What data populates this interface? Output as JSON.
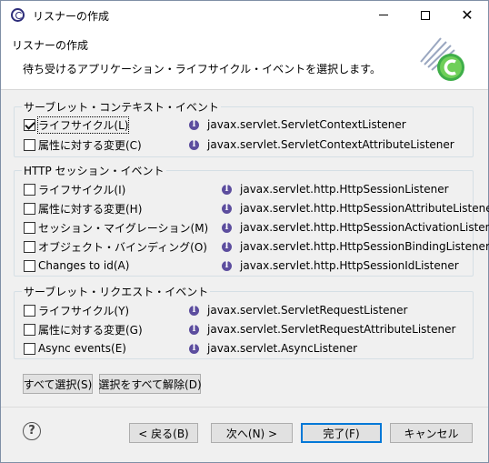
{
  "window": {
    "title": "リスナーの作成"
  },
  "header": {
    "title": "リスナーの作成",
    "description": "待ち受けるアプリケーション・ライフサイクル・イベントを選択します。"
  },
  "groups": [
    {
      "legend": "サーブレット・コンテキスト・イベント",
      "rows": [
        {
          "label": "ライフサイクル(L)",
          "checked": true,
          "interface": "javax.servlet.ServletContextListener"
        },
        {
          "label": "属性に対する変更(C)",
          "checked": false,
          "interface": "javax.servlet.ServletContextAttributeListener"
        }
      ]
    },
    {
      "legend": "HTTP セッション・イベント",
      "rows": [
        {
          "label": "ライフサイクル(I)",
          "checked": false,
          "interface": "javax.servlet.http.HttpSessionListener"
        },
        {
          "label": "属性に対する変更(H)",
          "checked": false,
          "interface": "javax.servlet.http.HttpSessionAttributeListener"
        },
        {
          "label": "セッション・マイグレーション(M)",
          "checked": false,
          "interface": "javax.servlet.http.HttpSessionActivationListener"
        },
        {
          "label": "オブジェクト・バインディング(O)",
          "checked": false,
          "interface": "javax.servlet.http.HttpSessionBindingListener"
        },
        {
          "label": "Changes to id(A)",
          "checked": false,
          "interface": "javax.servlet.http.HttpSessionIdListener"
        }
      ]
    },
    {
      "legend": "サーブレット・リクエスト・イベント",
      "rows": [
        {
          "label": "ライフサイクル(Y)",
          "checked": false,
          "interface": "javax.servlet.ServletRequestListener"
        },
        {
          "label": "属性に対する変更(G)",
          "checked": false,
          "interface": "javax.servlet.ServletRequestAttributeListener"
        },
        {
          "label": "Async events(E)",
          "checked": false,
          "interface": "javax.servlet.AsyncListener"
        }
      ]
    }
  ],
  "selection_buttons": {
    "select_all": "すべて選択(S)",
    "deselect_all": "選択をすべて解除(D)"
  },
  "footer": {
    "help": "?",
    "back": "< 戻る(B)",
    "next": "次へ(N) >",
    "finish": "完了(F)",
    "cancel": "キャンセル"
  },
  "icons": {
    "interface": "interface-icon",
    "wizard": "listener-wizard-icon"
  }
}
